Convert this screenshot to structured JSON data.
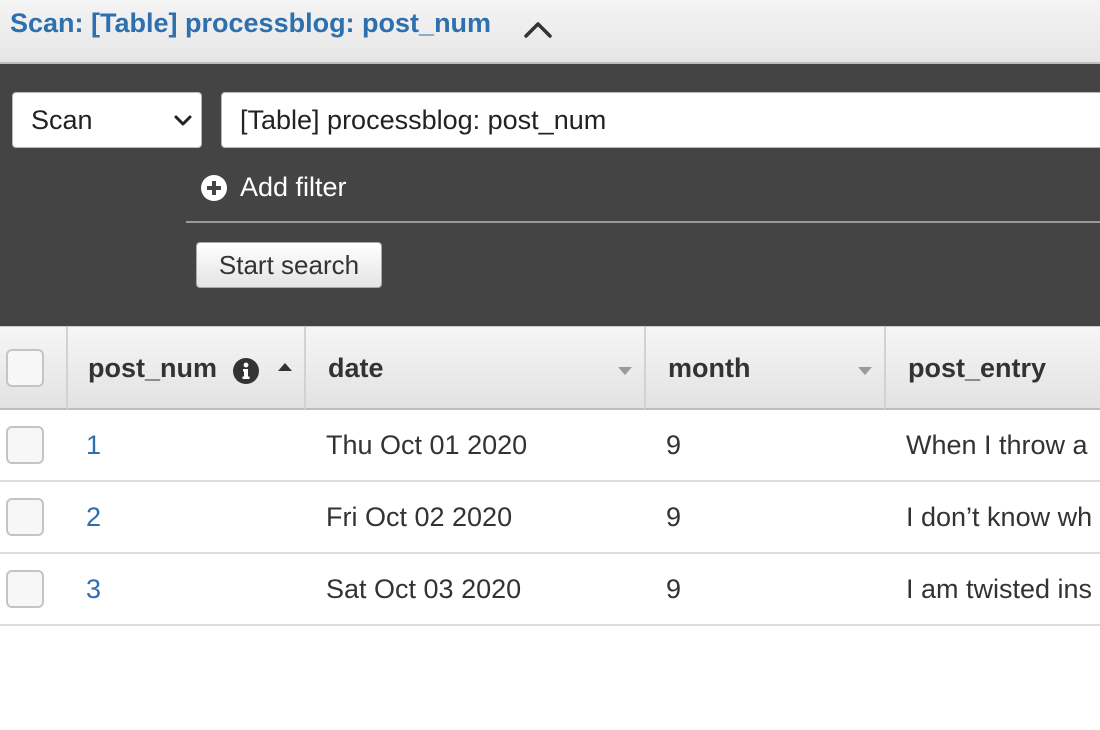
{
  "header": {
    "title": "Scan: [Table] processblog: post_num",
    "collapse_icon": "chevron-up-icon"
  },
  "search_panel": {
    "mode_selected": "Scan",
    "table_value": "[Table] processblog: post_num",
    "add_filter_label": "Add filter",
    "start_search_label": "Start search"
  },
  "table": {
    "columns": [
      {
        "label": "post_num",
        "sort": "ascending",
        "info_icon": true
      },
      {
        "label": "date",
        "sort": "none"
      },
      {
        "label": "month",
        "sort": "none"
      },
      {
        "label": "post_entry",
        "sort": "none"
      }
    ],
    "rows": [
      {
        "post_num": "1",
        "date": "Thu Oct 01 2020",
        "month": "9",
        "post_entry": "When I throw a"
      },
      {
        "post_num": "2",
        "date": "Fri Oct 02 2020",
        "month": "9",
        "post_entry": "I don’t know wh"
      },
      {
        "post_num": "3",
        "date": "Sat Oct 03 2020",
        "month": "9",
        "post_entry": "I am twisted ins"
      }
    ]
  },
  "colors": {
    "link": "#2e6fad",
    "panel_bg": "#444444"
  }
}
